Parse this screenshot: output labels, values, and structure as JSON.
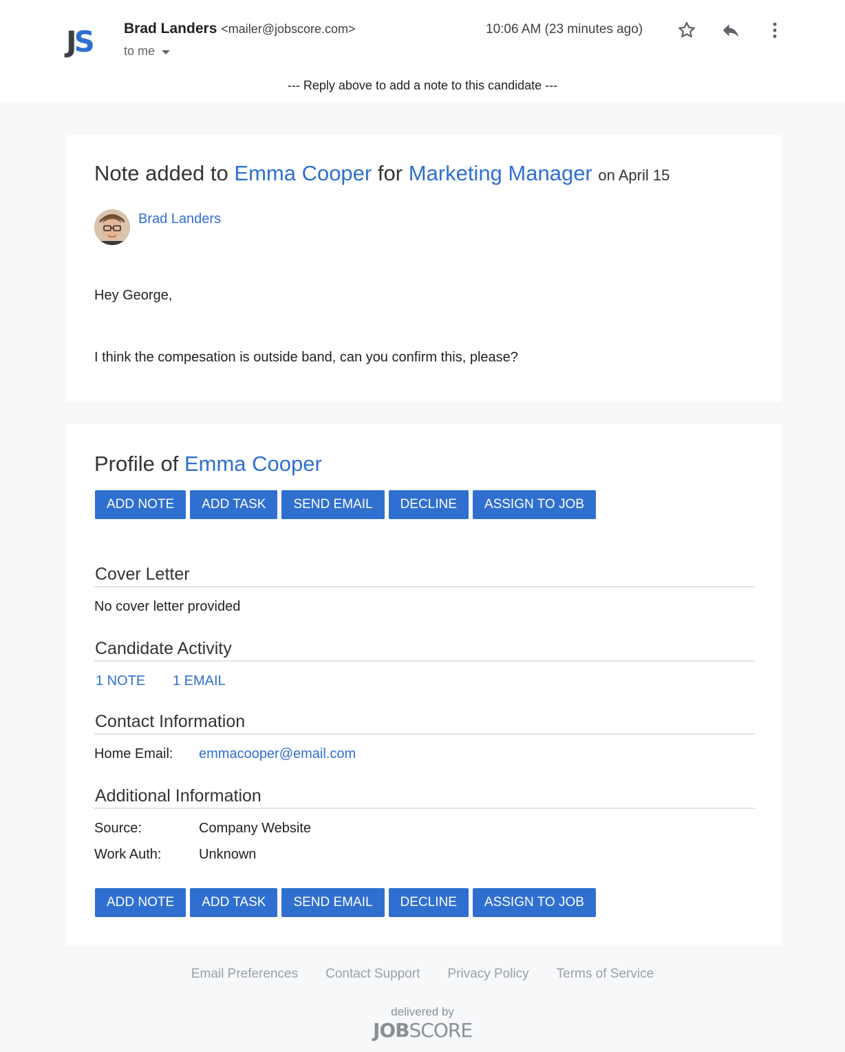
{
  "header": {
    "logo_j": "J",
    "logo_s": "S",
    "sender_name": "Brad Landers",
    "sender_email": "<mailer@jobscore.com>",
    "to_label": "to me",
    "time": "10:06 AM (23 minutes ago)",
    "reply_instruction": "--- Reply above to add a note to this candidate ---",
    "icons": [
      "star-icon",
      "reply-icon",
      "more-vert-icon"
    ]
  },
  "note": {
    "title_prefix": "Note added to",
    "candidate": "Emma Cooper",
    "title_for": "for",
    "job": "Marketing Manager",
    "date": "on April 15",
    "author": "Brad Landers",
    "greeting": "Hey George,",
    "message": "I think the compesation is outside band, can you confirm this, please?"
  },
  "profile": {
    "title_prefix": "Profile of",
    "candidate": "Emma Cooper",
    "buttons": [
      "ADD NOTE",
      "ADD TASK",
      "SEND EMAIL",
      "DECLINE",
      "ASSIGN TO JOB"
    ],
    "cover_letter_heading": "Cover Letter",
    "cover_letter_text": "No cover letter provided",
    "activity_heading": "Candidate Activity",
    "activity_notes": "1 NOTE",
    "activity_emails": "1 EMAIL",
    "contact_heading": "Contact Information",
    "home_email_label": "Home Email:",
    "home_email_value": "emmacooper@email.com",
    "additional_heading": "Additional Information",
    "source_label": "Source:",
    "source_value": "Company Website",
    "work_auth_label": "Work Auth:",
    "work_auth_value": "Unknown"
  },
  "footer": {
    "links": [
      "Email Preferences",
      "Contact Support",
      "Privacy Policy",
      "Terms of Service"
    ],
    "delivered_by": "delivered by",
    "brand_bold": "JOB",
    "brand_light": "SCORE"
  },
  "colors": {
    "accent": "#2f6fd0",
    "page_bg": "#f7f8fa",
    "muted": "#9aa0a6"
  }
}
